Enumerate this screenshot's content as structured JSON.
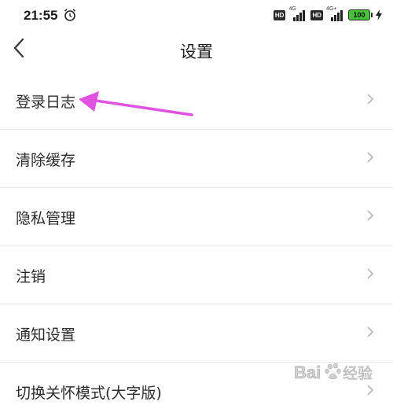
{
  "status_bar": {
    "time": "21:55",
    "battery": "100",
    "network1": "4G",
    "network2": "4G+",
    "hd_label": "HD"
  },
  "header": {
    "title": "设置"
  },
  "menu": {
    "items": [
      {
        "label": "登录日志"
      },
      {
        "label": "清除缓存"
      },
      {
        "label": "隐私管理"
      },
      {
        "label": "注销"
      },
      {
        "label": "通知设置"
      },
      {
        "label": "切换关怀模式(大字版)"
      }
    ]
  },
  "annotation": {
    "color": "#e052e0"
  },
  "watermark": {
    "text": "Bai 经验"
  }
}
